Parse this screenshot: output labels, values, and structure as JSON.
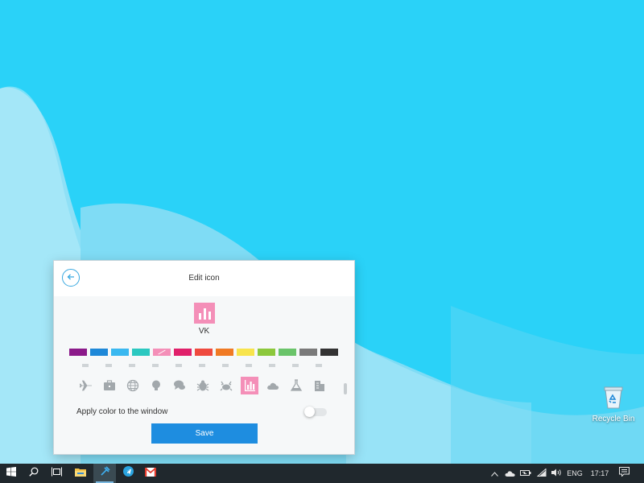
{
  "desktop": {
    "icons": [
      {
        "label": "Recycle Bin",
        "icon": "recycle-bin-icon"
      }
    ]
  },
  "dialog": {
    "title": "Edit icon",
    "back_icon": "arrow-left-icon",
    "preview": {
      "icon": "bar-chart-icon",
      "color": "#f48fb8",
      "label": "VK"
    },
    "colors": [
      {
        "name": "purple",
        "hex": "#8b1a8a"
      },
      {
        "name": "blue",
        "hex": "#1e88d8"
      },
      {
        "name": "light-blue",
        "hex": "#3ab8f0"
      },
      {
        "name": "teal",
        "hex": "#2bc8c0"
      },
      {
        "name": "pink",
        "hex": "#f48fb8",
        "selected": true
      },
      {
        "name": "magenta",
        "hex": "#e0206a"
      },
      {
        "name": "red",
        "hex": "#ef4a3e"
      },
      {
        "name": "orange",
        "hex": "#f07a24"
      },
      {
        "name": "yellow",
        "hex": "#f8e44c"
      },
      {
        "name": "lime",
        "hex": "#8cc83c"
      },
      {
        "name": "green",
        "hex": "#6ac46a"
      },
      {
        "name": "gray",
        "hex": "#7a7a7a"
      },
      {
        "name": "dark-gray",
        "hex": "#333333"
      }
    ],
    "icons": [
      {
        "name": "airplane-icon"
      },
      {
        "name": "briefcase-icon"
      },
      {
        "name": "globe-icon"
      },
      {
        "name": "lightbulb-icon"
      },
      {
        "name": "chat-icon"
      },
      {
        "name": "bug-icon"
      },
      {
        "name": "crab-icon"
      },
      {
        "name": "bar-chart-icon",
        "selected": true
      },
      {
        "name": "cloud-icon"
      },
      {
        "name": "flask-icon"
      },
      {
        "name": "buildings-icon"
      }
    ],
    "apply_color_label": "Apply color to the window",
    "apply_color_enabled": false,
    "save_label": "Save"
  },
  "taskbar": {
    "start_icon": "windows-logo-icon",
    "search_icon": "search-icon",
    "task_view_icon": "task-view-icon",
    "apps": [
      {
        "name": "file-explorer-icon",
        "active": false
      },
      {
        "name": "pin-app-icon",
        "active": true
      },
      {
        "name": "telegram-icon",
        "active": false
      },
      {
        "name": "gmail-icon",
        "active": false
      }
    ],
    "tray": {
      "chevron_icon": "chevron-up-icon",
      "weather_icon": "cloud-icon",
      "battery_icon": "battery-icon",
      "wifi_icon": "wifi-icon",
      "volume_icon": "speaker-icon",
      "language": "ENG",
      "time": "17:17",
      "notification_icon": "notification-icon"
    }
  }
}
